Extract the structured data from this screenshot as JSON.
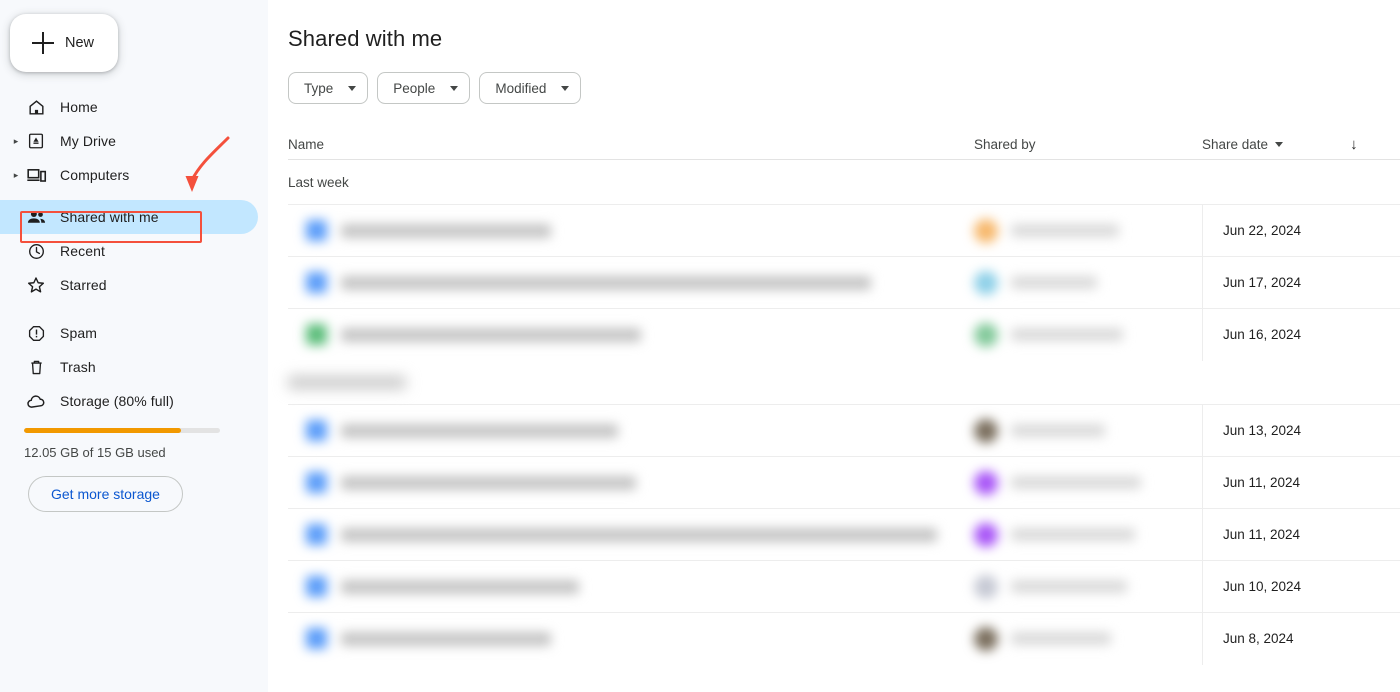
{
  "sidebar": {
    "new_button": {
      "label": "New",
      "icon": "plus-icon"
    },
    "items": [
      {
        "label": "Home",
        "icon": "home-icon",
        "expandable": false,
        "active": false
      },
      {
        "label": "My Drive",
        "icon": "drive-icon",
        "expandable": true,
        "active": false
      },
      {
        "label": "Computers",
        "icon": "computer-icon",
        "expandable": true,
        "active": false
      },
      {
        "label": "Shared with me",
        "icon": "people-icon",
        "expandable": false,
        "active": true
      },
      {
        "label": "Recent",
        "icon": "clock-icon",
        "expandable": false,
        "active": false
      },
      {
        "label": "Starred",
        "icon": "star-icon",
        "expandable": false,
        "active": false
      }
    ],
    "items_lower": [
      {
        "label": "Spam",
        "icon": "spam-icon"
      },
      {
        "label": "Trash",
        "icon": "trash-icon"
      },
      {
        "label": "Storage (80% full)",
        "icon": "cloud-icon"
      }
    ],
    "storage": {
      "percent_full": 80,
      "usage_text": "12.05 GB of 15 GB used",
      "cta_label": "Get more storage",
      "bar_color": "#f29900"
    }
  },
  "annotation": {
    "color": "#f4503c",
    "highlight_target": "Shared with me",
    "arrow": "curved-down-arrow"
  },
  "main": {
    "title": "Shared with me",
    "filter_chips": [
      {
        "label": "Type",
        "icon": "chevron-down-icon"
      },
      {
        "label": "People",
        "icon": "chevron-down-icon"
      },
      {
        "label": "Modified",
        "icon": "chevron-down-icon"
      }
    ],
    "columns": {
      "name": "Name",
      "shared_by": "Shared by",
      "share_date": "Share date",
      "sort_direction_icon": "arrow-down-icon"
    },
    "groups": [
      {
        "label": "Last week",
        "redacted": false,
        "rows": [
          {
            "file_icon_color": "#5b9df9",
            "name_width": 210,
            "avatar_color": "#f7b86c",
            "sharedby_width": 108,
            "date": "Jun 22, 2024"
          },
          {
            "file_icon_color": "#5b9df9",
            "name_width": 530,
            "avatar_color": "#8ed0e8",
            "sharedby_width": 86,
            "date": "Jun 17, 2024"
          },
          {
            "file_icon_color": "#5bbd7a",
            "name_width": 300,
            "avatar_color": "#82c99a",
            "sharedby_width": 112,
            "date": "Jun 16, 2024"
          }
        ]
      },
      {
        "label": "Earlier this month",
        "redacted": true,
        "rows": [
          {
            "file_icon_color": "#5b9df9",
            "name_width": 277,
            "avatar_color": "#7a6e5d",
            "sharedby_width": 94,
            "date": "Jun 13, 2024"
          },
          {
            "file_icon_color": "#5b9df9",
            "name_width": 295,
            "avatar_color": "#a855f7",
            "sharedby_width": 130,
            "date": "Jun 11, 2024"
          },
          {
            "file_icon_color": "#5b9df9",
            "name_width": 596,
            "avatar_color": "#a855f7",
            "sharedby_width": 124,
            "date": "Jun 11, 2024"
          },
          {
            "file_icon_color": "#5b9df9",
            "name_width": 238,
            "avatar_color": "#c6c9d4",
            "sharedby_width": 116,
            "date": "Jun 10, 2024"
          },
          {
            "file_icon_color": "#5b9df9",
            "name_width": 210,
            "avatar_color": "#7a6e5d",
            "sharedby_width": 100,
            "date": "Jun 8, 2024"
          }
        ]
      }
    ]
  }
}
